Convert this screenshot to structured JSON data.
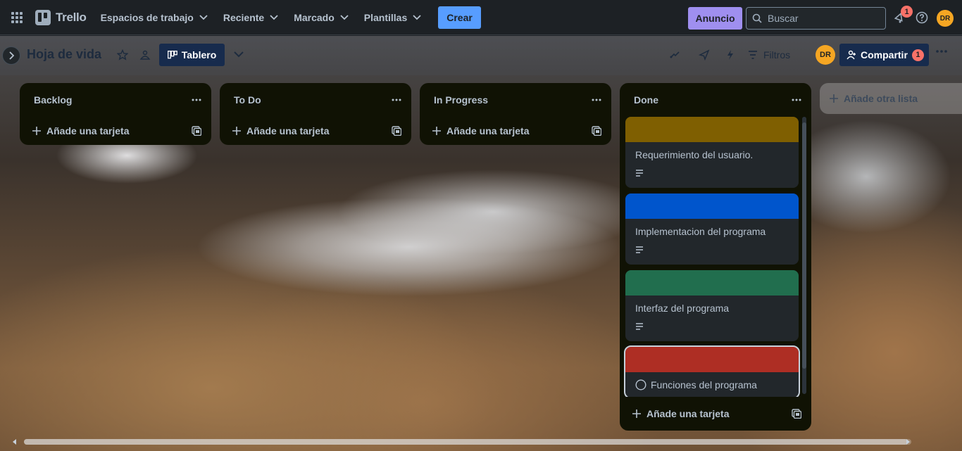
{
  "app": {
    "name": "Trello"
  },
  "nav": {
    "items": [
      {
        "label": "Espacios de trabajo"
      },
      {
        "label": "Reciente"
      },
      {
        "label": "Marcado"
      },
      {
        "label": "Plantillas"
      }
    ],
    "create_label": "Crear",
    "announcement_label": "Anuncio",
    "search_placeholder": "Buscar",
    "notification_count": "1",
    "user_initials": "DR"
  },
  "board": {
    "title": "Hoja de vida",
    "view_label": "Tablero",
    "filters_label": "Filtros",
    "member_initials": "DR",
    "share_label": "Compartir",
    "share_count": "1",
    "add_list_label": "Añade otra lista"
  },
  "lists": [
    {
      "title": "Backlog",
      "add_card_label": "Añade una tarjeta"
    },
    {
      "title": "To Do",
      "add_card_label": "Añade una tarjeta"
    },
    {
      "title": "In Progress",
      "add_card_label": "Añade una tarjeta"
    },
    {
      "title": "Done",
      "add_card_label": "Añade una tarjeta",
      "cards": [
        {
          "title": "Requerimiento del usuario.",
          "cover_color": "#7f5f01",
          "has_description": true
        },
        {
          "title": "Implementacion del programa",
          "cover_color": "#0055cc",
          "has_description": true
        },
        {
          "title": "Interfaz del programa",
          "cover_color": "#216e4e",
          "has_description": true
        },
        {
          "title": "Funciones del programa",
          "cover_color": "#ae2e24",
          "has_checkbox": true
        }
      ]
    }
  ],
  "colors": {
    "accent": "#579dff",
    "announcement": "#9f8fef",
    "badge": "#f87168",
    "avatar": "#f5a623",
    "list_bg": "#101204",
    "card_bg": "#22272b"
  }
}
